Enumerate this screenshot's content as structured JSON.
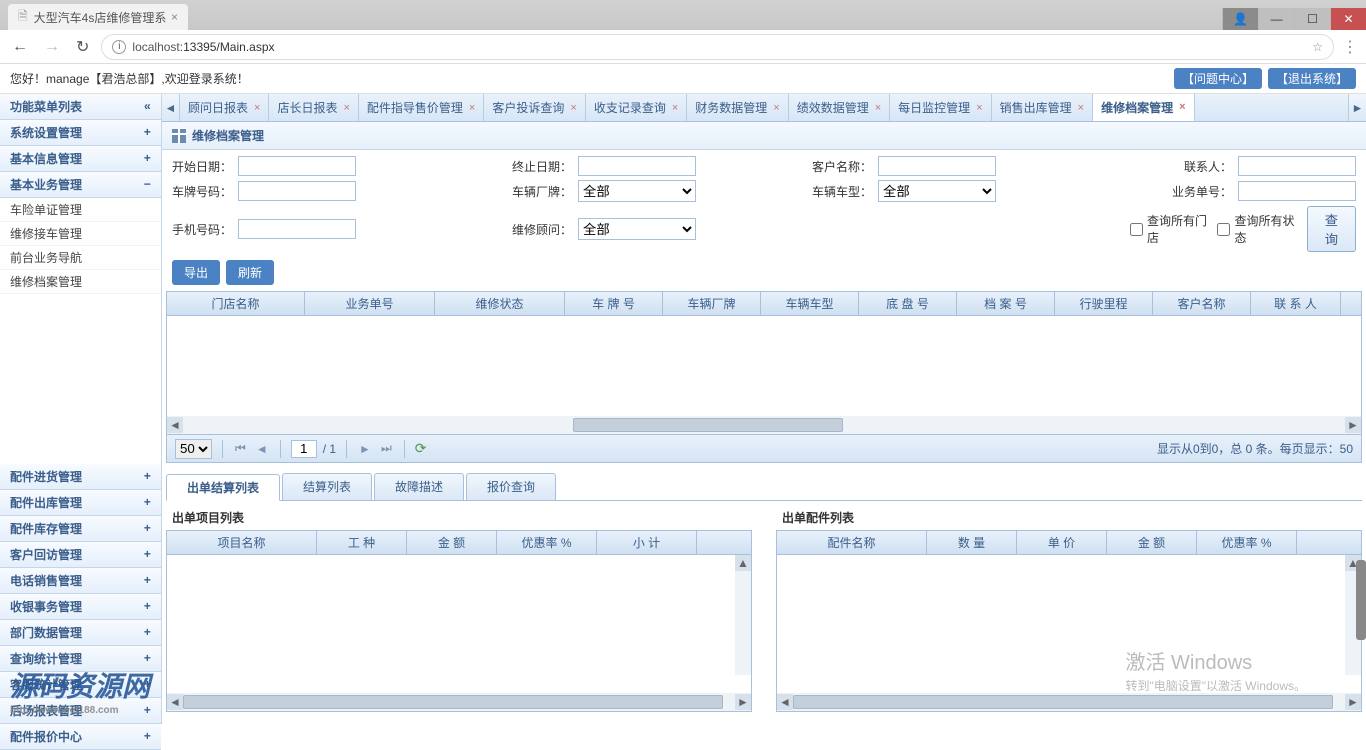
{
  "browser": {
    "tab_title": "大型汽车4s店维修管理系",
    "url_host": "localhost:",
    "url_port_path": "13395/Main.aspx"
  },
  "header": {
    "greeting": "您好！manage【君浩总部】,欢迎登录系统！",
    "btn_issue": "【问题中心】",
    "btn_logout": "【退出系统】"
  },
  "sidebar": {
    "title": "功能菜单列表",
    "groups": [
      {
        "label": "系统设置管理",
        "toggle": "+"
      },
      {
        "label": "基本信息管理",
        "toggle": "+"
      },
      {
        "label": "基本业务管理",
        "toggle": "−",
        "children": [
          "车险单证管理",
          "维修接车管理",
          "前台业务导航",
          "维修档案管理"
        ]
      },
      {
        "label": "配件进货管理",
        "toggle": "+"
      },
      {
        "label": "配件出库管理",
        "toggle": "+"
      },
      {
        "label": "配件库存管理",
        "toggle": "+"
      },
      {
        "label": "客户回访管理",
        "toggle": "+"
      },
      {
        "label": "电话销售管理",
        "toggle": "+"
      },
      {
        "label": "收银事务管理",
        "toggle": "+"
      },
      {
        "label": "部门数据管理",
        "toggle": "+"
      },
      {
        "label": "查询统计管理",
        "toggle": "+"
      },
      {
        "label": "客服统计管理",
        "toggle": "+"
      },
      {
        "label": "后场报表管理",
        "toggle": "+"
      },
      {
        "label": "配件报价中心",
        "toggle": "+"
      }
    ]
  },
  "tabs": [
    "顾问日报表",
    "店长日报表",
    "配件指导售价管理",
    "客户投诉查询",
    "收支记录查询",
    "财务数据管理",
    "绩效数据管理",
    "每日监控管理",
    "销售出库管理",
    "维修档案管理"
  ],
  "active_tab": 9,
  "page": {
    "title": "维修档案管理"
  },
  "filters": {
    "start_date": "开始日期：",
    "end_date": "终止日期：",
    "customer": "客户名称：",
    "contact": "联系人：",
    "plate": "车牌号码：",
    "brand": "车辆厂牌：",
    "all": "全部",
    "model": "车辆车型：",
    "order_no": "业务单号：",
    "phone": "手机号码：",
    "advisor": "维修顾问：",
    "chk_all_stores": "查询所有门店",
    "chk_all_status": "查询所有状态",
    "query": "查询"
  },
  "actions": {
    "export": "导出",
    "refresh": "刷新"
  },
  "grid_cols": [
    "门店名称",
    "业务单号",
    "维修状态",
    "车 牌 号",
    "车辆厂牌",
    "车辆车型",
    "底 盘 号",
    "档 案 号",
    "行驶里程",
    "客户名称",
    "联 系 人"
  ],
  "grid_col_widths": [
    138,
    130,
    130,
    98,
    98,
    98,
    98,
    98,
    98,
    98,
    90
  ],
  "pager": {
    "size": "50",
    "page": "1",
    "total_pages": "/ 1",
    "info": "显示从0到0，总 0 条。每页显示：50"
  },
  "subtabs": [
    "出单结算列表",
    "结算列表",
    "故障描述",
    "报价查询"
  ],
  "active_subtab": 0,
  "left_panel": {
    "title": "出单项目列表",
    "cols": [
      "项目名称",
      "工 种",
      "金 额",
      "优惠率 %",
      "小 计"
    ],
    "widths": [
      150,
      90,
      90,
      100,
      100
    ]
  },
  "right_panel": {
    "title": "出单配件列表",
    "cols": [
      "配件名称",
      "数 量",
      "单 价",
      "金 额",
      "优惠率 %"
    ],
    "widths": [
      150,
      90,
      90,
      90,
      100
    ]
  },
  "watermark": {
    "title": "激活 Windows",
    "sub": "转到\"电脑设置\"以激活 Windows。"
  },
  "logo_wm": {
    "text": "源码资源网",
    "url": "http://www.net188.com"
  }
}
